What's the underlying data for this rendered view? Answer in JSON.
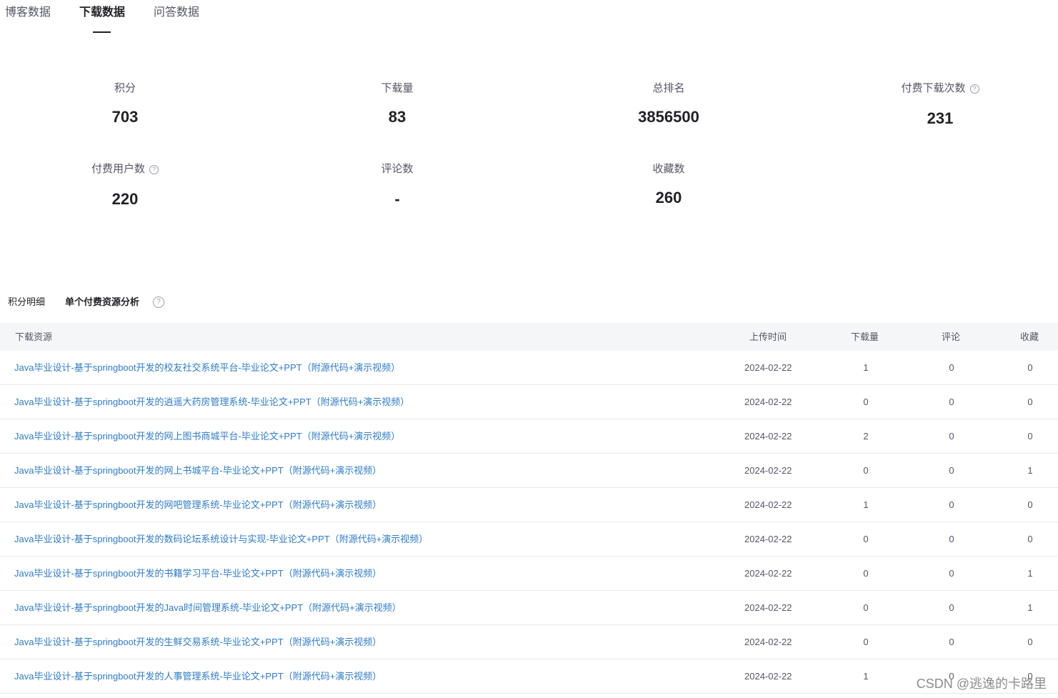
{
  "tabs": [
    {
      "label": "博客数据"
    },
    {
      "label": "下载数据"
    },
    {
      "label": "问答数据"
    }
  ],
  "stats": {
    "points": {
      "label": "积分",
      "value": "703"
    },
    "downloads": {
      "label": "下载量",
      "value": "83"
    },
    "rank": {
      "label": "总排名",
      "value": "3856500"
    },
    "paid_downloads": {
      "label": "付费下载次数",
      "value": "231"
    },
    "paid_users": {
      "label": "付费用户数",
      "value": "220"
    },
    "comments": {
      "label": "评论数",
      "value": "-"
    },
    "favorites": {
      "label": "收藏数",
      "value": "260"
    }
  },
  "help_glyph": "?",
  "subtabs": [
    {
      "label": "积分明细"
    },
    {
      "label": "单个付费资源分析"
    }
  ],
  "table": {
    "headers": {
      "resource": "下载资源",
      "upload_time": "上传时间",
      "downloads": "下载量",
      "comments": "评论",
      "favorites": "收藏"
    },
    "rows": [
      {
        "title": "Java毕业设计-基于springboot开发的校友社交系统平台-毕业论文+PPT（附源代码+演示视频）",
        "date": "2024-02-22",
        "downloads": "1",
        "comments": "0",
        "favorites": "0"
      },
      {
        "title": "Java毕业设计-基于springboot开发的逍遥大药房管理系统-毕业论文+PPT（附源代码+演示视频）",
        "date": "2024-02-22",
        "downloads": "0",
        "comments": "0",
        "favorites": "0"
      },
      {
        "title": "Java毕业设计-基于springboot开发的网上图书商城平台-毕业论文+PPT（附源代码+演示视频）",
        "date": "2024-02-22",
        "downloads": "2",
        "comments": "0",
        "favorites": "0"
      },
      {
        "title": "Java毕业设计-基于springboot开发的网上书城平台-毕业论文+PPT（附源代码+演示视频）",
        "date": "2024-02-22",
        "downloads": "0",
        "comments": "0",
        "favorites": "1"
      },
      {
        "title": "Java毕业设计-基于springboot开发的网吧管理系统-毕业论文+PPT（附源代码+演示视频）",
        "date": "2024-02-22",
        "downloads": "1",
        "comments": "0",
        "favorites": "0"
      },
      {
        "title": "Java毕业设计-基于springboot开发的数码论坛系统设计与实现-毕业论文+PPT（附源代码+演示视频）",
        "date": "2024-02-22",
        "downloads": "0",
        "comments": "0",
        "favorites": "0"
      },
      {
        "title": "Java毕业设计-基于springboot开发的书籍学习平台-毕业论文+PPT（附源代码+演示视频）",
        "date": "2024-02-22",
        "downloads": "0",
        "comments": "0",
        "favorites": "1"
      },
      {
        "title": "Java毕业设计-基于springboot开发的Java时间管理系统-毕业论文+PPT（附源代码+演示视频）",
        "date": "2024-02-22",
        "downloads": "0",
        "comments": "0",
        "favorites": "1"
      },
      {
        "title": "Java毕业设计-基于springboot开发的生鲜交易系统-毕业论文+PPT（附源代码+演示视频）",
        "date": "2024-02-22",
        "downloads": "0",
        "comments": "0",
        "favorites": "0"
      },
      {
        "title": "Java毕业设计-基于springboot开发的人事管理系统-毕业论文+PPT（附源代码+演示视频）",
        "date": "2024-02-22",
        "downloads": "1",
        "comments": "0",
        "favorites": "0"
      }
    ]
  },
  "watermark": "CSDN @逃逸的卡路里"
}
